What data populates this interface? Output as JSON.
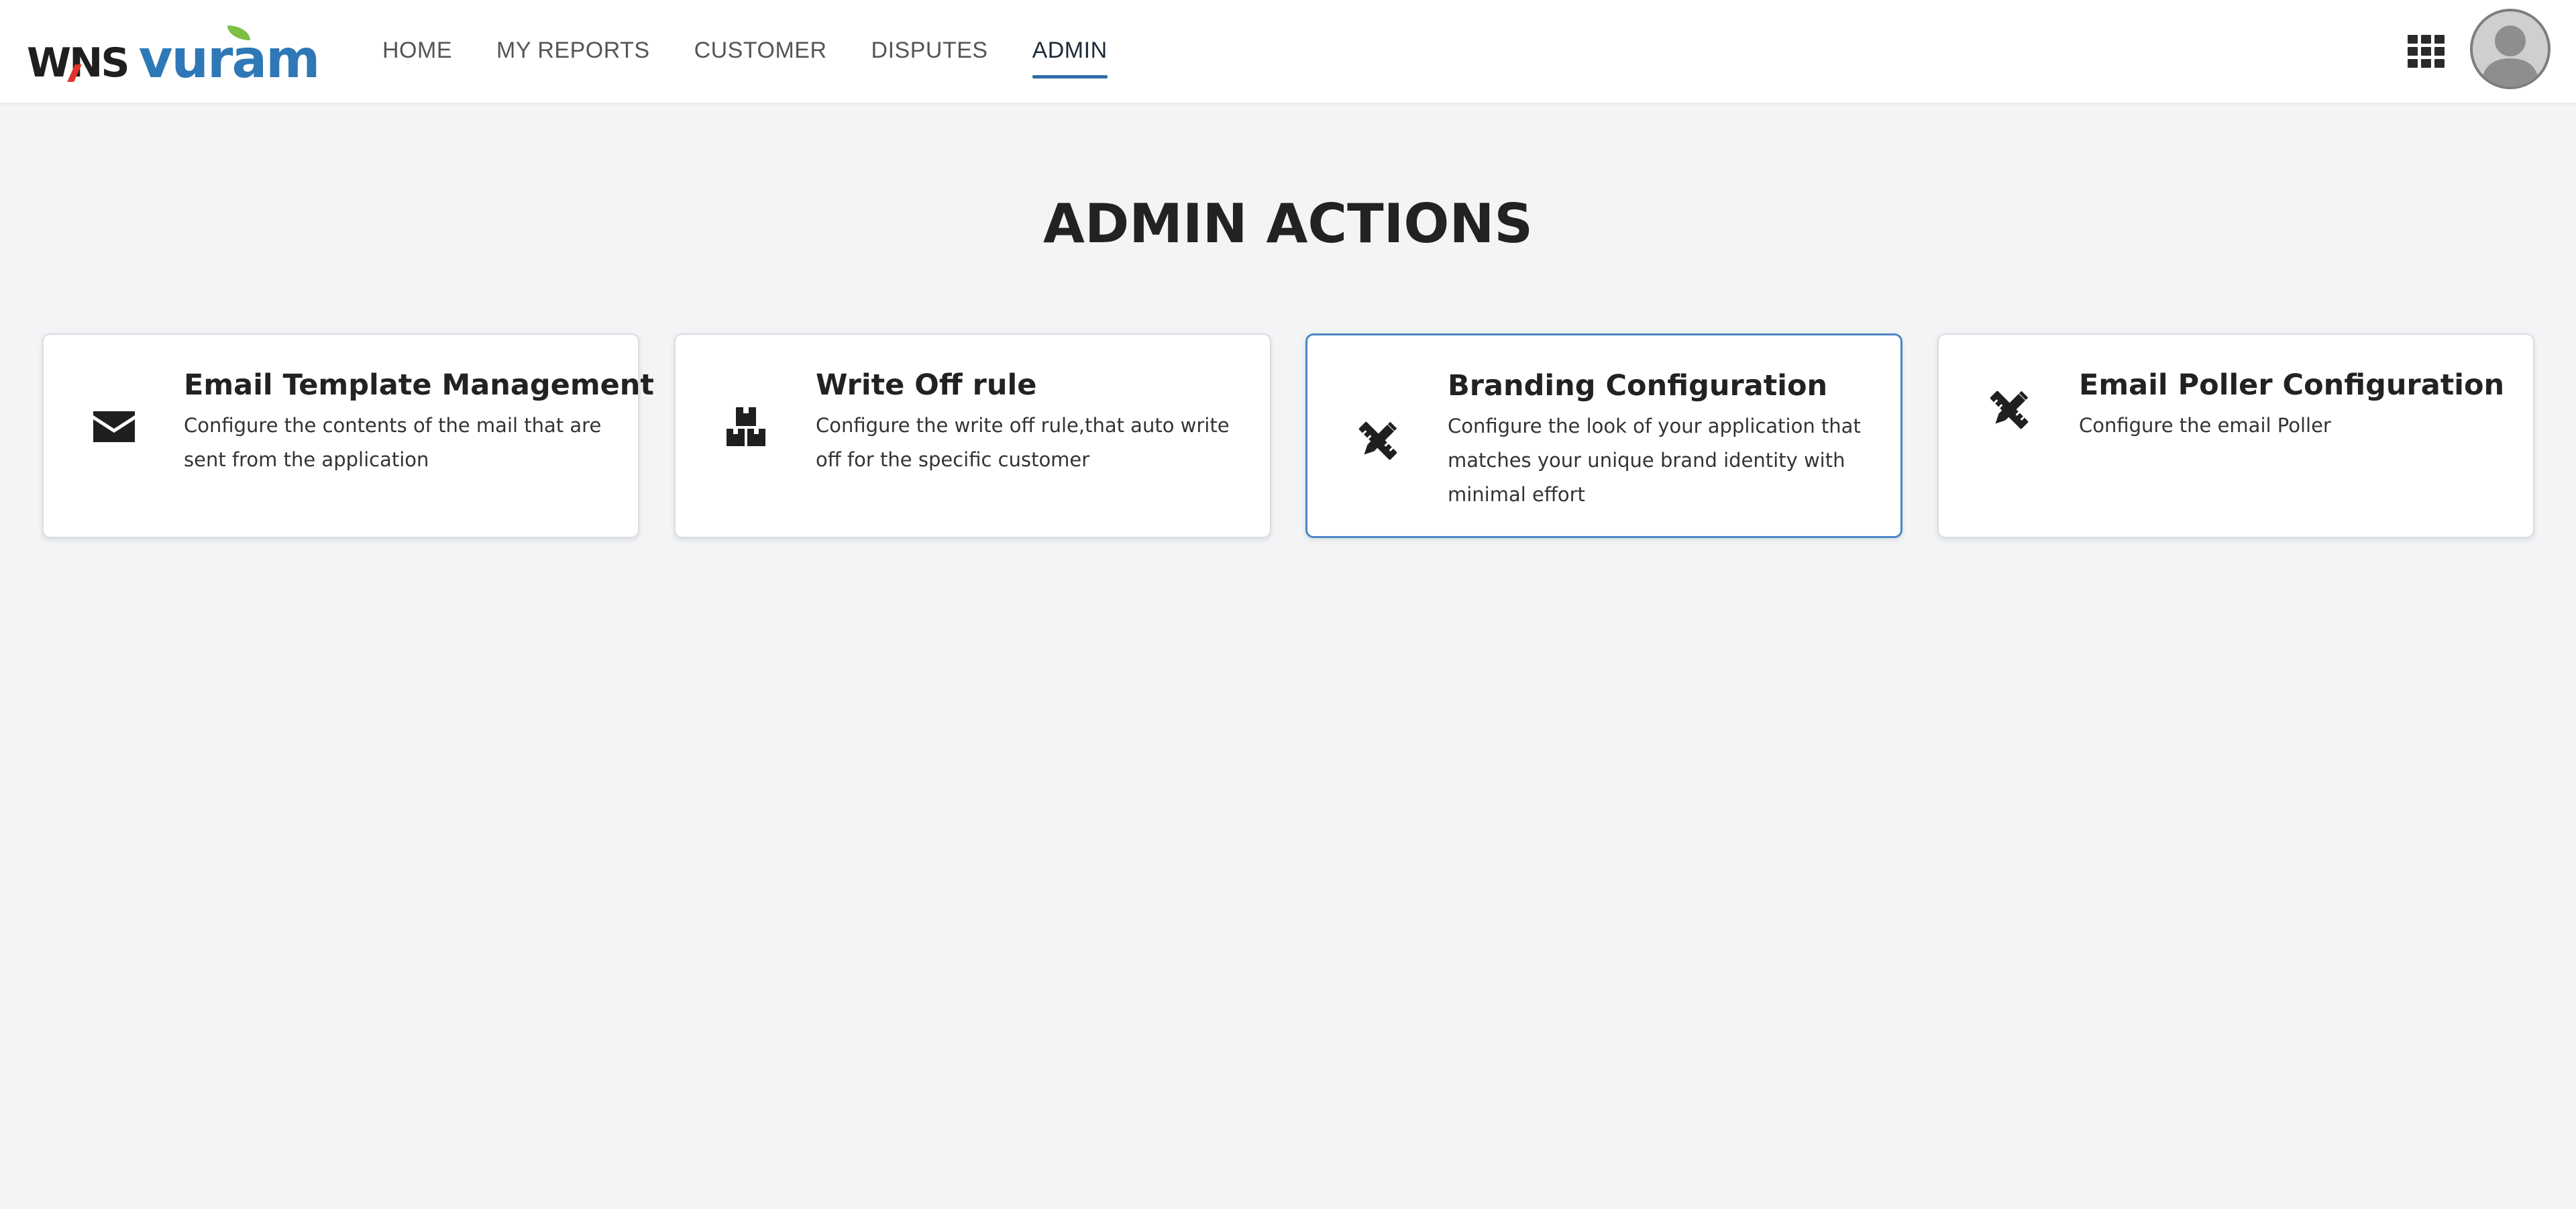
{
  "header": {
    "logo": {
      "brand_left": "WNS",
      "brand_right": "vuram"
    },
    "nav": [
      {
        "label": "HOME",
        "active": false
      },
      {
        "label": "MY REPORTS",
        "active": false
      },
      {
        "label": "CUSTOMER",
        "active": false
      },
      {
        "label": "DISPUTES",
        "active": false
      },
      {
        "label": "ADMIN",
        "active": true
      }
    ],
    "apps_icon": "grid-apps-icon",
    "avatar_icon": "user-avatar-icon"
  },
  "main": {
    "title": "ADMIN ACTIONS",
    "cards": [
      {
        "icon": "envelope-icon",
        "title": "Email Template Management",
        "description": "Configure the contents of the mail that are sent from the application",
        "selected": false
      },
      {
        "icon": "cubes-icon",
        "title": "Write Off rule",
        "description": "Configure the write off rule,that auto write off for the specific customer",
        "selected": false
      },
      {
        "icon": "pencil-ruler-icon",
        "title": "Branding Configuration",
        "description": "Configure the look of your application that matches your unique brand identity with minimal effort",
        "selected": true
      },
      {
        "icon": "pencil-ruler-icon",
        "title": "Email Poller Configuration",
        "description": "Configure the email Poller",
        "selected": false
      }
    ]
  },
  "colors": {
    "background": "#f3f4f6",
    "header_bg": "#ffffff",
    "accent_blue": "#2e6ea8",
    "selected_border": "#4a86c6",
    "logo_blue": "#2e78b7",
    "logo_green": "#7cc043",
    "logo_red": "#e0342c"
  }
}
